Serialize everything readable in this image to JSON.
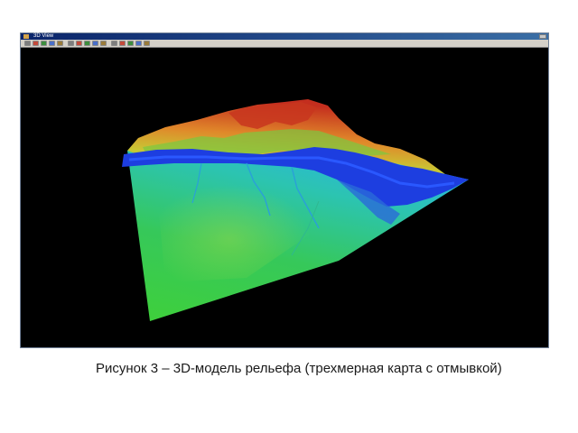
{
  "window": {
    "title": "3D View",
    "toolbar_buttons": [
      {
        "icon": "toolbar-tool-icon",
        "color": "#7d7d7d"
      },
      {
        "icon": "toolbar-tool-icon",
        "color": "#c34a3a"
      },
      {
        "icon": "toolbar-tool-icon",
        "color": "#3d8d3d"
      },
      {
        "icon": "toolbar-tool-icon",
        "color": "#4a6fc9"
      },
      {
        "icon": "toolbar-tool-icon",
        "color": "#9a7b3a"
      },
      {
        "icon": "toolbar-tool-icon",
        "color": "#7d7d7d"
      },
      {
        "icon": "toolbar-tool-icon",
        "color": "#c34a3a"
      },
      {
        "icon": "toolbar-tool-icon",
        "color": "#3d8d3d"
      },
      {
        "icon": "toolbar-tool-icon",
        "color": "#4a6fc9"
      },
      {
        "icon": "toolbar-tool-icon",
        "color": "#9a7b3a"
      },
      {
        "icon": "toolbar-tool-icon",
        "color": "#7d7d7d"
      },
      {
        "icon": "toolbar-tool-icon",
        "color": "#c34a3a"
      },
      {
        "icon": "toolbar-tool-icon",
        "color": "#3d8d3d"
      },
      {
        "icon": "toolbar-tool-icon",
        "color": "#4a6fc9"
      },
      {
        "icon": "toolbar-tool-icon",
        "color": "#9a7b3a"
      }
    ]
  },
  "terrain_colors": {
    "lowland_green": "#3cc83a",
    "plain_cyan": "#29c6b4",
    "river_blue": "#1d3ee0",
    "foothill_yellow": "#d8c233",
    "mountain_orange": "#e0782a",
    "peak_red": "#c83020"
  },
  "caption": {
    "text": "Рисунок 3 – 3D-модель рельефа (трехмерная карта с отмывкой)"
  }
}
